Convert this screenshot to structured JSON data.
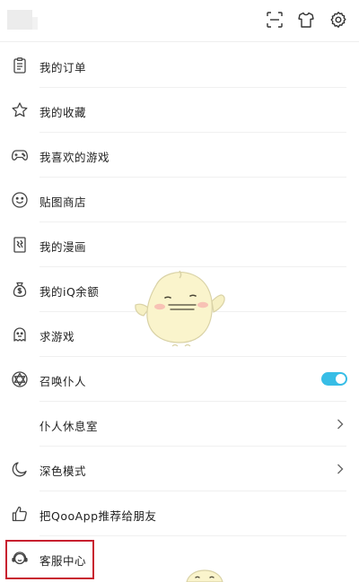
{
  "menu": {
    "items": [
      {
        "label": "我的订单",
        "icon": "clipboard-icon"
      },
      {
        "label": "我的收藏",
        "icon": "star-icon"
      },
      {
        "label": "我喜欢的游戏",
        "icon": "gamepad-icon"
      },
      {
        "label": "贴图商店",
        "icon": "smiley-icon"
      },
      {
        "label": "我的漫画",
        "icon": "comic-icon"
      },
      {
        "label": "我的iQ余额",
        "icon": "money-bag-icon"
      },
      {
        "label": "求游戏",
        "icon": "ghost-icon"
      },
      {
        "label": "召唤仆人",
        "icon": "summon-star-icon",
        "toggle_on": true
      },
      {
        "label": "仆人休息室"
      },
      {
        "label": "深色模式",
        "icon": "moon-icon"
      },
      {
        "label": "把QooApp推荐给朋友",
        "icon": "thumbs-up-icon"
      },
      {
        "label": "客服中心",
        "icon": "support-icon"
      }
    ]
  },
  "colors": {
    "accent": "#37bde6",
    "highlight_border": "#c8202f"
  }
}
